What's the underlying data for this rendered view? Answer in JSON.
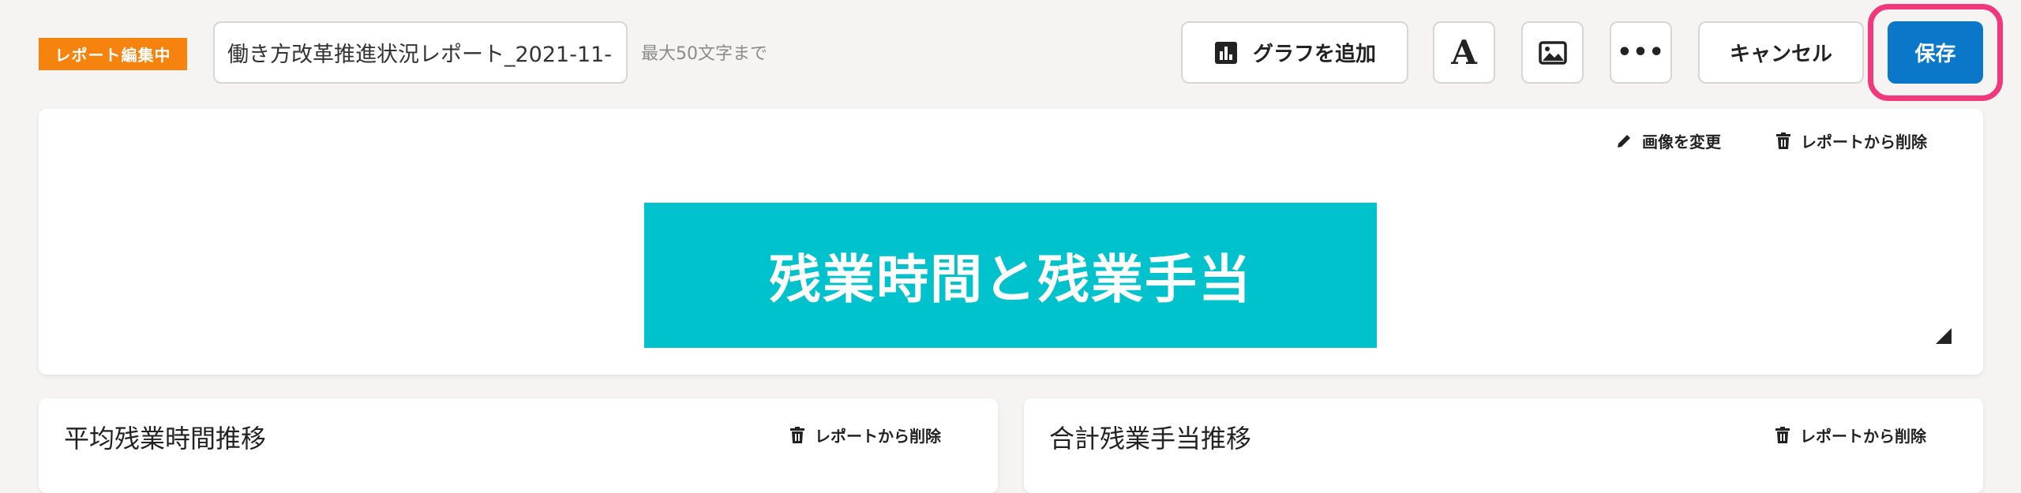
{
  "header": {
    "status_badge": "レポート編集中",
    "report_title_value": "働き方改革推進状況レポート_2021-11-",
    "title_hint": "最大50文字まで",
    "add_graph_label": "グラフを追加",
    "text_button_glyph": "A",
    "more_button_glyph": "•••",
    "cancel_label": "キャンセル",
    "save_label": "保存"
  },
  "banner": {
    "change_image_label": "画像を変更",
    "delete_label": "レポートから削除",
    "image_text": "残業時間と残業手当"
  },
  "widgets": [
    {
      "title": "平均残業時間推移",
      "delete_label": "レポートから削除"
    },
    {
      "title": "合計残業手当推移",
      "delete_label": "レポートから削除"
    }
  ],
  "colors": {
    "badge": "#f5830e",
    "save": "#0b77c9",
    "highlight_ring": "#f2387d",
    "banner_bg": "#00c2cc"
  }
}
